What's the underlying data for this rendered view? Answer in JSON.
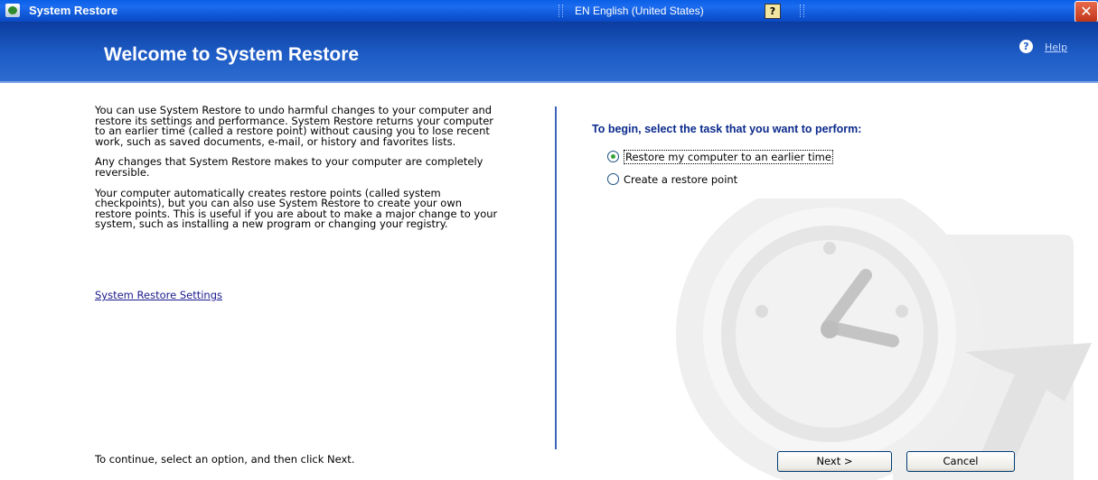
{
  "window": {
    "title": "System Restore",
    "language_bar": "EN English (United States)",
    "close_label": "✕"
  },
  "header": {
    "title": "Welcome to System Restore",
    "help_label": "Help"
  },
  "left": {
    "paragraphs": [
      "You can use System Restore to undo harmful changes to your computer and restore its settings and performance. System Restore returns your computer to an earlier time (called a restore point) without causing you to lose recent work, such as saved documents, e-mail, or history and favorites lists.",
      "Any changes that System Restore makes to your computer are completely reversible.",
      "Your computer automatically creates restore points (called system checkpoints), but you can also use System Restore to create your own restore points. This is useful if you are about to make a major change to your system, such as installing a new program or changing your registry."
    ],
    "settings_link": "System Restore Settings",
    "footer_hint": "To continue, select an option, and then click Next."
  },
  "right": {
    "prompt": "To begin, select the task that you want to perform:",
    "options": [
      {
        "label": "Restore my computer to an earlier time",
        "selected": true
      },
      {
        "label": "Create a restore point",
        "selected": false
      }
    ]
  },
  "buttons": {
    "next": "Next >",
    "cancel": "Cancel"
  },
  "colors": {
    "titlebar": "#0a5fe6",
    "header": "#1e5cc6",
    "prompt": "#0b2a8c",
    "link": "#1a1a8c"
  }
}
